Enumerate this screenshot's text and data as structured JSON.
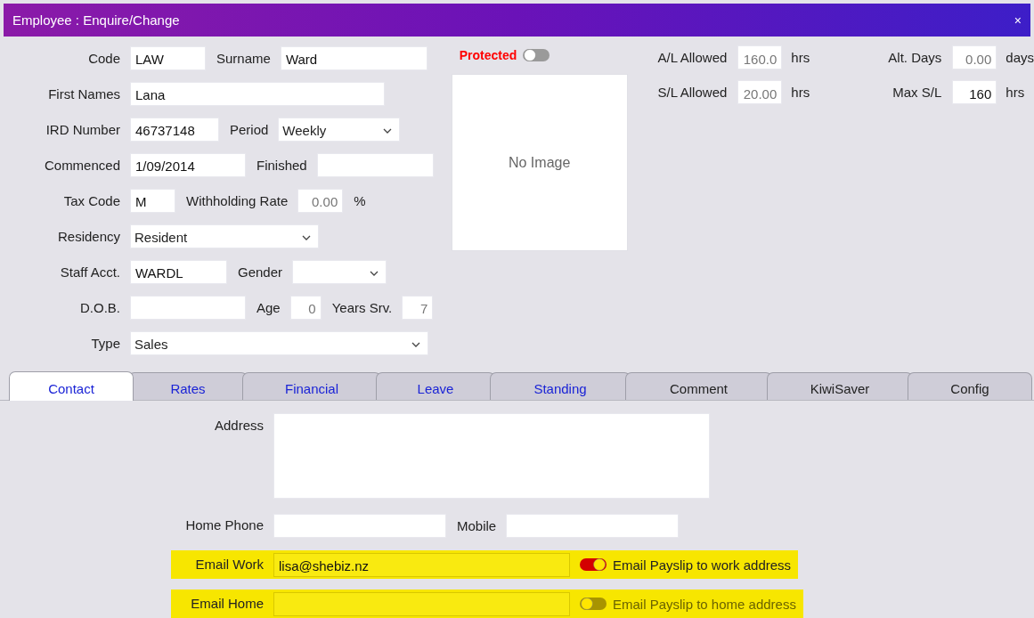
{
  "window": {
    "title": "Employee : Enquire/Change",
    "close": "×"
  },
  "form_rows": [
    {
      "items": [
        {
          "kind": "label",
          "text": "Code"
        },
        {
          "kind": "field",
          "value": "LAW"
        },
        {
          "kind": "label",
          "text": "Surname"
        },
        {
          "kind": "field",
          "value": "Ward"
        }
      ]
    },
    {
      "items": [
        {
          "kind": "label",
          "text": "First Names"
        },
        {
          "kind": "field",
          "value": "Lana"
        }
      ]
    },
    {
      "items": [
        {
          "kind": "label",
          "text": "IRD Number"
        },
        {
          "kind": "field",
          "value": "46737148"
        },
        {
          "kind": "label",
          "text": "Period"
        },
        {
          "kind": "select",
          "value": "Weekly"
        }
      ]
    },
    {
      "items": [
        {
          "kind": "label",
          "text": "Commenced"
        },
        {
          "kind": "field",
          "value": "1/09/2014"
        },
        {
          "kind": "label",
          "text": "Finished"
        },
        {
          "kind": "field"
        }
      ]
    },
    {
      "items": [
        {
          "kind": "label",
          "text": "Tax Code"
        },
        {
          "kind": "field",
          "value": "M"
        },
        {
          "kind": "label",
          "text": "Withholding Rate"
        },
        {
          "kind": "number",
          "value": "0.00",
          "disabled": true
        },
        {
          "kind": "unit",
          "text": "%"
        }
      ]
    },
    {
      "items": [
        {
          "kind": "label",
          "text": "Residency"
        },
        {
          "kind": "select",
          "value": "Resident"
        }
      ]
    },
    {
      "items": [
        {
          "kind": "label",
          "text": "Staff Acct."
        },
        {
          "kind": "field",
          "value": "WARDL"
        },
        {
          "kind": "label",
          "text": "Gender"
        },
        {
          "kind": "select"
        }
      ]
    },
    {
      "items": [
        {
          "kind": "label",
          "text": "D.O.B."
        },
        {
          "kind": "field"
        },
        {
          "kind": "label",
          "text": "Age"
        },
        {
          "kind": "number",
          "value": "0",
          "disabled": true
        },
        {
          "kind": "label",
          "text": "Years Srv."
        },
        {
          "kind": "number",
          "value": "7",
          "disabled": true
        }
      ]
    },
    {
      "items": [
        {
          "kind": "label",
          "text": "Type"
        },
        {
          "kind": "select",
          "value": "Sales"
        }
      ]
    }
  ],
  "protected": {
    "label": "Protected",
    "on": false
  },
  "photo": {
    "placeholder": "No Image"
  },
  "allowances": [
    {
      "label": "A/L Allowed",
      "value": "160.0",
      "disabled": true,
      "unit": "hrs"
    },
    {
      "label": "Alt. Days",
      "value": "0.00",
      "disabled": true,
      "unit": "days"
    },
    {
      "label": "S/L Allowed",
      "value": "20.00",
      "disabled": true,
      "unit": "hrs"
    },
    {
      "label": "Max S/L",
      "value": "160",
      "disabled": false,
      "unit": "hrs"
    }
  ],
  "tabs": [
    {
      "label": "Contact",
      "selected": true,
      "linked": true
    },
    {
      "label": "Rates",
      "selected": false,
      "linked": true
    },
    {
      "label": "Financial",
      "selected": false,
      "linked": true
    },
    {
      "label": "Leave",
      "selected": false,
      "linked": true
    },
    {
      "label": "Standing",
      "selected": false,
      "linked": true
    },
    {
      "label": "Comment",
      "selected": false,
      "linked": false
    },
    {
      "label": "KiwiSaver",
      "selected": false,
      "linked": false
    },
    {
      "label": "Config",
      "selected": false,
      "linked": false
    }
  ],
  "contact": {
    "address": {
      "label": "Address"
    },
    "home_phone": {
      "label": "Home Phone"
    },
    "mobile": {
      "label": "Mobile"
    },
    "emails": [
      {
        "label": "Email Work",
        "value": "lisa@shebiz.nz",
        "highlighted": true,
        "payslip": {
          "label": "Email Payslip to work address",
          "on": true
        }
      },
      {
        "label": "Email Home",
        "highlighted": true,
        "payslip": {
          "label": "Email Payslip to home address",
          "on": false
        }
      }
    ]
  }
}
